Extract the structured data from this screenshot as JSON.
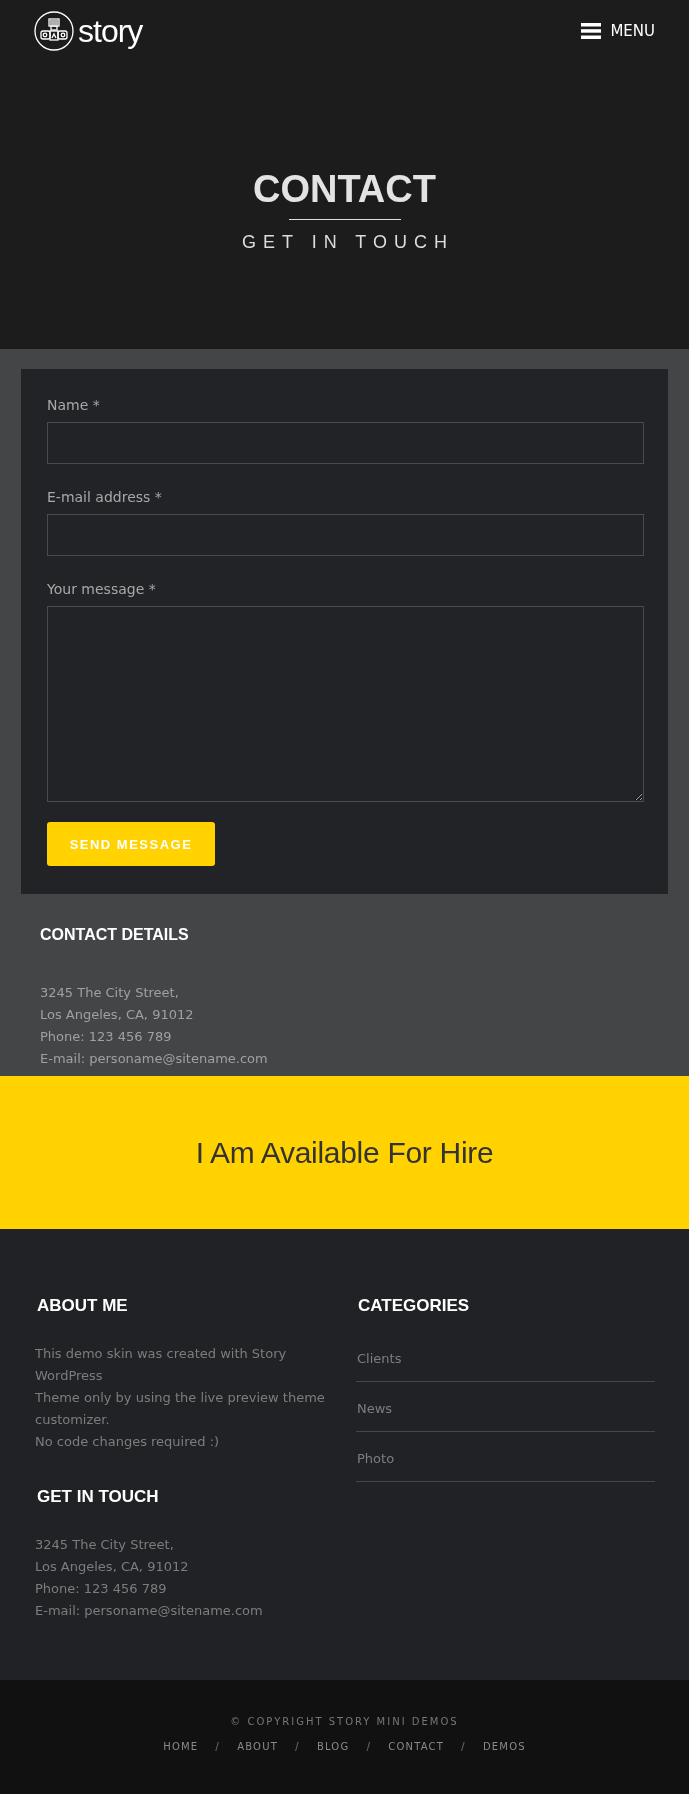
{
  "header": {
    "logo_text": "story",
    "menu_label": "MENU"
  },
  "hero": {
    "title": "CONTACT",
    "subtitle": "GET IN TOUCH"
  },
  "form": {
    "fields": [
      {
        "kind": "input",
        "label": "Name *"
      },
      {
        "kind": "input",
        "label": "E-mail address *"
      },
      {
        "kind": "textarea",
        "label": "Your message *"
      }
    ],
    "submit": "SEND MESSAGE"
  },
  "contact_details": {
    "title": "CONTACT DETAILS",
    "lines": [
      "3245 The City Street,",
      "Los Angeles, CA, 91012",
      "Phone: 123 456 789",
      "E-mail: personame@sitename.com"
    ]
  },
  "banner": {
    "text": "I Am Available For Hire"
  },
  "footer": {
    "about": {
      "title": "ABOUT ME",
      "lines": [
        "This demo skin was created with Story WordPress",
        "Theme only by using the live preview theme customizer.",
        "No code changes required :)"
      ]
    },
    "categories": {
      "title": "CATEGORIES",
      "items": [
        "Clients",
        "News",
        "Photo"
      ]
    },
    "get_in_touch": {
      "title": "GET IN TOUCH",
      "lines": [
        "3245 The City Street,",
        "Los Angeles, CA, 91012",
        "Phone: 123 456 789",
        "E-mail: personame@sitename.com"
      ]
    }
  },
  "bottom_bar": {
    "copyright": "© COPYRIGHT STORY MINI DEMOS",
    "nav": [
      {
        "kind": "link",
        "text": "HOME"
      },
      {
        "kind": "separator",
        "text": "/"
      },
      {
        "kind": "link",
        "text": "ABOUT"
      },
      {
        "kind": "separator",
        "text": "/"
      },
      {
        "kind": "link",
        "text": "BLOG"
      },
      {
        "kind": "separator",
        "text": "/"
      },
      {
        "kind": "link",
        "text": "CONTACT"
      },
      {
        "kind": "separator",
        "text": "/"
      },
      {
        "kind": "link",
        "text": "DEMOS"
      }
    ]
  }
}
